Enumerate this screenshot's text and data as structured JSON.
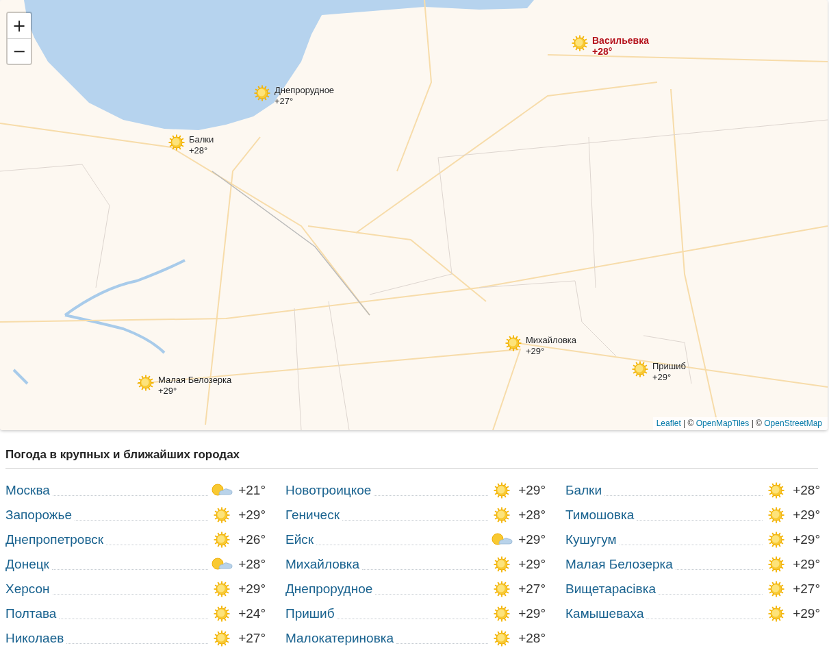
{
  "map": {
    "zoom_controls": [
      "+",
      "−"
    ],
    "markers": [
      {
        "name": "Васильевка",
        "temp": "+28°",
        "kind": "sunny",
        "current": true
      },
      {
        "name": "Днепрорудное",
        "temp": "+27°",
        "kind": "sunny",
        "current": false
      },
      {
        "name": "Балки",
        "temp": "+28°",
        "kind": "sunny",
        "current": false
      },
      {
        "name": "Михайловка",
        "temp": "+29°",
        "kind": "sunny",
        "current": false
      },
      {
        "name": "Пришиб",
        "temp": "+29°",
        "kind": "sunny",
        "current": false
      },
      {
        "name": "Малая Белозерка",
        "temp": "+29°",
        "kind": "sunny",
        "current": false
      }
    ],
    "attribution": [
      {
        "kind": "link",
        "text": "Leaflet"
      },
      {
        "kind": "text",
        "text": "| ©"
      },
      {
        "kind": "link",
        "text": "OpenMapTiles"
      },
      {
        "kind": "text",
        "text": "| ©"
      },
      {
        "kind": "link",
        "text": "OpenStreetMap"
      }
    ]
  },
  "cities": {
    "title": "Погода в крупных и ближайших городах",
    "columns": [
      [
        {
          "name": "Москва",
          "kind": "partly-cloudy",
          "temp": "+21°"
        },
        {
          "name": "Запорожье",
          "kind": "sunny",
          "temp": "+29°"
        },
        {
          "name": "Днепропетровск",
          "kind": "sunny",
          "temp": "+26°"
        },
        {
          "name": "Донецк",
          "kind": "partly-cloudy",
          "temp": "+28°"
        },
        {
          "name": "Херсон",
          "kind": "sunny",
          "temp": "+29°"
        },
        {
          "name": "Полтава",
          "kind": "sunny",
          "temp": "+24°"
        },
        {
          "name": "Николаев",
          "kind": "sunny",
          "temp": "+27°"
        }
      ],
      [
        {
          "name": "Новотроицкое",
          "kind": "sunny",
          "temp": "+29°"
        },
        {
          "name": "Геническ",
          "kind": "sunny",
          "temp": "+28°"
        },
        {
          "name": "Ейск",
          "kind": "partly-cloudy",
          "temp": "+29°"
        },
        {
          "name": "Михайловка",
          "kind": "sunny",
          "temp": "+29°"
        },
        {
          "name": "Днепрорудное",
          "kind": "sunny",
          "temp": "+27°"
        },
        {
          "name": "Пришиб",
          "kind": "sunny",
          "temp": "+29°"
        },
        {
          "name": "Малокатериновка",
          "kind": "sunny",
          "temp": "+28°"
        }
      ],
      [
        {
          "name": "Балки",
          "kind": "sunny",
          "temp": "+28°"
        },
        {
          "name": "Тимошовка",
          "kind": "sunny",
          "temp": "+29°"
        },
        {
          "name": "Кушугум",
          "kind": "sunny",
          "temp": "+29°"
        },
        {
          "name": "Малая Белозерка",
          "kind": "sunny",
          "temp": "+29°"
        },
        {
          "name": "Вищетарасівка",
          "kind": "sunny",
          "temp": "+27°"
        },
        {
          "name": "Камышеваха",
          "kind": "sunny",
          "temp": "+29°"
        }
      ]
    ]
  }
}
